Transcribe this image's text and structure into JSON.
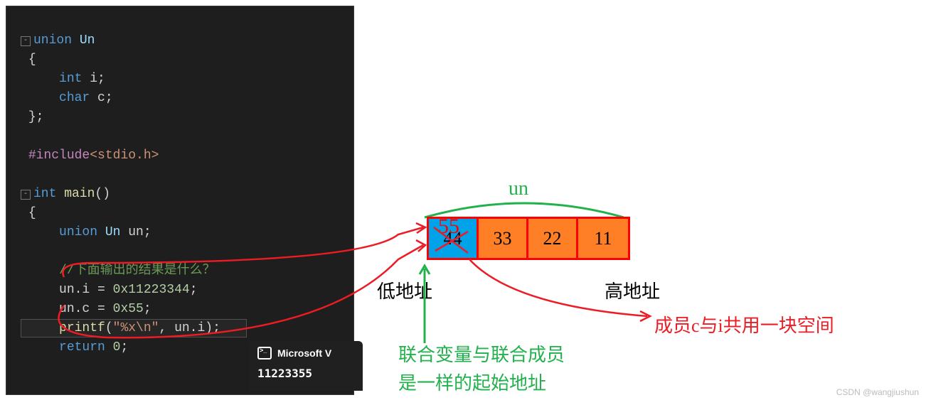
{
  "code": {
    "l1_union": "union",
    "l1_name": " Un",
    "l2": "{",
    "l3_type": "int",
    "l3_var": " i;",
    "l4_type": "char",
    "l4_var": " c;",
    "l5": "};",
    "l7_inc": "#include",
    "l7_hdr": "<stdio.h>",
    "l9_int": "int",
    "l9_main": " main",
    "l9_par": "()",
    "l10": "{",
    "l11_union": "union",
    "l11_type": " Un",
    "l11_var": " un;",
    "l13_cmt": "//下面输出的结果是什么？",
    "l14": "un.i = ",
    "l14_num": "0x11223344",
    "l14_end": ";",
    "l15": "un.c = ",
    "l15_num": "0x55",
    "l15_end": ";",
    "l16_fn": "printf",
    "l16_open": "(",
    "l16_str": "\"%x\\n\"",
    "l16_rest": ", un.i);",
    "l17_ret": "return",
    "l17_val": " 0",
    "l17_end": ";"
  },
  "console": {
    "title": "Microsoft V",
    "output": "11223355"
  },
  "diagram": {
    "un_label": "un",
    "cells": [
      "44",
      "33",
      "22",
      "11"
    ],
    "overlay": "55",
    "low": "低地址",
    "high": "高地址",
    "green_note_l1": "联合变量与联合成员",
    "green_note_l2": "是一样的起始地址",
    "red_note": "成员c与i共用一块空间"
  },
  "watermark": "CSDN @wangjiushun"
}
